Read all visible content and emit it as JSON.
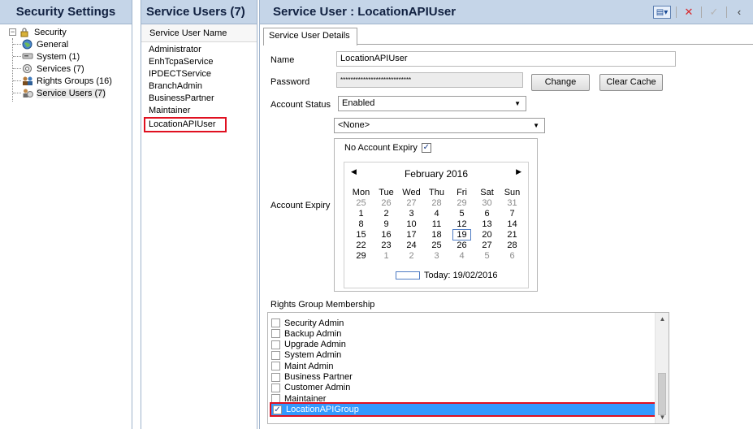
{
  "left": {
    "title": "Security Settings",
    "tree": [
      {
        "label": "Security",
        "icon": "lock-icon",
        "level": 0
      },
      {
        "label": "General",
        "icon": "globe-icon",
        "level": 1
      },
      {
        "label": "System (1)",
        "icon": "system-icon",
        "level": 1
      },
      {
        "label": "Services (7)",
        "icon": "services-icon",
        "level": 1
      },
      {
        "label": "Rights Groups (16)",
        "icon": "rights-groups-icon",
        "level": 1
      },
      {
        "label": "Service Users (7)",
        "icon": "service-users-icon",
        "level": 1
      }
    ]
  },
  "middle": {
    "title": "Service Users (7)",
    "column_header": "Service User Name",
    "users": [
      "Administrator",
      "EnhTcpaService",
      "IPDECTService",
      "BranchAdmin",
      "BusinessPartner",
      "Maintainer",
      "LocationAPIUser"
    ],
    "selected_user": "LocationAPIUser"
  },
  "right": {
    "title": "Service User :  LocationAPIUser",
    "toolbar": {
      "new_icon": "new-item-icon",
      "delete_icon": "delete-icon",
      "ok_icon": "check-icon",
      "back_icon": "back-icon"
    },
    "tab": "Service User Details",
    "form": {
      "name_label": "Name",
      "name_value": "LocationAPIUser",
      "password_label": "Password",
      "password_value": "****************************",
      "change_button": "Change",
      "clear_cache_button": "Clear Cache",
      "account_status_label": "Account Status",
      "account_status_value": "Enabled",
      "second_combo_value": "<None>",
      "account_expiry_label": "Account Expiry",
      "no_account_expiry_label": "No Account Expiry",
      "no_account_expiry_checked": true,
      "rights_group_label": "Rights Group Membership"
    },
    "calendar": {
      "month": "February 2016",
      "day_headers": [
        "Mon",
        "Tue",
        "Wed",
        "Thu",
        "Fri",
        "Sat",
        "Sun"
      ],
      "weeks": [
        [
          "25",
          "26",
          "27",
          "28",
          "29",
          "30",
          "31"
        ],
        [
          "1",
          "2",
          "3",
          "4",
          "5",
          "6",
          "7"
        ],
        [
          "8",
          "9",
          "10",
          "11",
          "12",
          "13",
          "14"
        ],
        [
          "15",
          "16",
          "17",
          "18",
          "19",
          "20",
          "21"
        ],
        [
          "22",
          "23",
          "24",
          "25",
          "26",
          "27",
          "28"
        ],
        [
          "29",
          "1",
          "2",
          "3",
          "4",
          "5",
          "6"
        ]
      ],
      "today_label": "Today: 19/02/2016"
    },
    "rights_groups": [
      {
        "label": "Security Admin",
        "checked": false
      },
      {
        "label": "Backup Admin",
        "checked": false
      },
      {
        "label": "Upgrade Admin",
        "checked": false
      },
      {
        "label": "System Admin",
        "checked": false
      },
      {
        "label": "Maint Admin",
        "checked": false
      },
      {
        "label": "Business Partner",
        "checked": false
      },
      {
        "label": "Customer Admin",
        "checked": false
      },
      {
        "label": "Maintainer",
        "checked": false
      },
      {
        "label": "LocationAPIGroup",
        "checked": true
      }
    ]
  }
}
